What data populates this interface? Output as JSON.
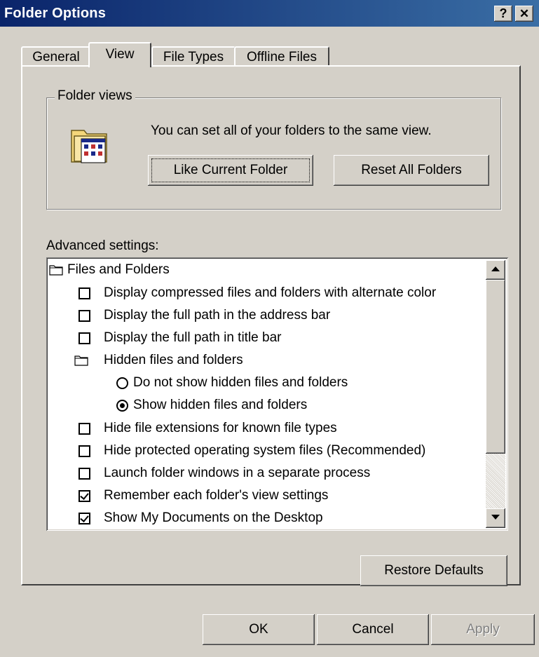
{
  "window": {
    "title": "Folder Options",
    "help_glyph": "?",
    "close_glyph": "✕"
  },
  "tabs": [
    {
      "label": "General",
      "active": false
    },
    {
      "label": "View",
      "active": true
    },
    {
      "label": "File Types",
      "active": false
    },
    {
      "label": "Offline Files",
      "active": false
    }
  ],
  "folder_views": {
    "legend": "Folder views",
    "description": "You can set all of your folders to the same view.",
    "like_current_button": {
      "label": "Like Current Folder",
      "mnemonic": "L"
    },
    "reset_all_button": {
      "label": "Reset All Folders",
      "mnemonic": "R"
    },
    "icon": "folder-view-icon"
  },
  "advanced": {
    "label": "Advanced settings:",
    "items": [
      {
        "type": "group",
        "label": "Files and Folders",
        "icon": "folder-icon"
      },
      {
        "type": "checkbox",
        "label": "Display compressed files and folders with alternate color",
        "checked": false
      },
      {
        "type": "checkbox",
        "label": "Display the full path in the address bar",
        "checked": false
      },
      {
        "type": "checkbox",
        "label": "Display the full path in title bar",
        "checked": false
      },
      {
        "type": "group",
        "label": "Hidden files and folders",
        "icon": "folder-icon"
      },
      {
        "type": "radio",
        "label": "Do not show hidden files and folders",
        "checked": false
      },
      {
        "type": "radio",
        "label": "Show hidden files and folders",
        "checked": true
      },
      {
        "type": "checkbox",
        "label": "Hide file extensions for known file types",
        "checked": false
      },
      {
        "type": "checkbox",
        "label": "Hide protected operating system files (Recommended)",
        "checked": false
      },
      {
        "type": "checkbox",
        "label": "Launch folder windows in a separate process",
        "checked": false
      },
      {
        "type": "checkbox",
        "label": "Remember each folder's view settings",
        "checked": true
      },
      {
        "type": "checkbox",
        "label": "Show My Documents on the Desktop",
        "checked": true
      }
    ]
  },
  "restore_defaults_button": {
    "label": "Restore Defaults",
    "mnemonic": "D"
  },
  "dialog_buttons": {
    "ok": "OK",
    "cancel": "Cancel",
    "apply": "Apply"
  },
  "colors": {
    "face": "#d4d0c8",
    "title_start": "#0a246a",
    "title_end": "#3a6ea5",
    "disabled_text": "#808080"
  }
}
